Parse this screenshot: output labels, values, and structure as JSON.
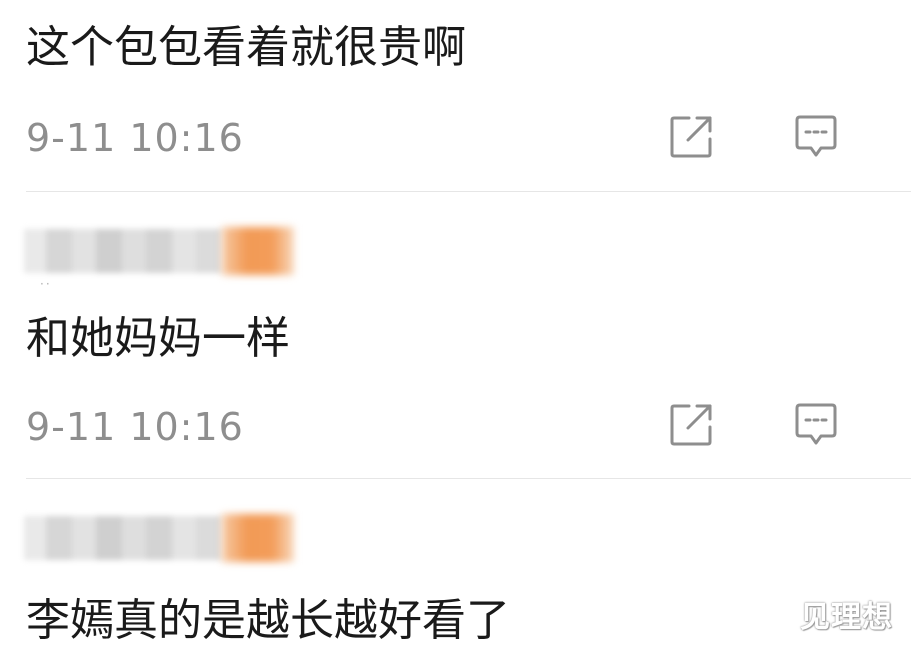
{
  "comments": [
    {
      "text": "这个包包看着就很贵啊",
      "timestamp": "9-11 10:16",
      "share_icon": "share-external-icon",
      "reply_icon": "comment-reply-icon"
    },
    {
      "text": "和她妈妈一样",
      "timestamp": "9-11 10:16",
      "share_icon": "share-external-icon",
      "reply_icon": "comment-reply-icon"
    },
    {
      "text": "李嫣真的是越长越好看了"
    }
  ],
  "watermark": "见理想",
  "colors": {
    "text": "#1a1a1a",
    "timestamp": "#8e8e8e",
    "icon": "#8e8e8e",
    "divider": "#e6e6e6",
    "level_badge": "#f29a55"
  }
}
